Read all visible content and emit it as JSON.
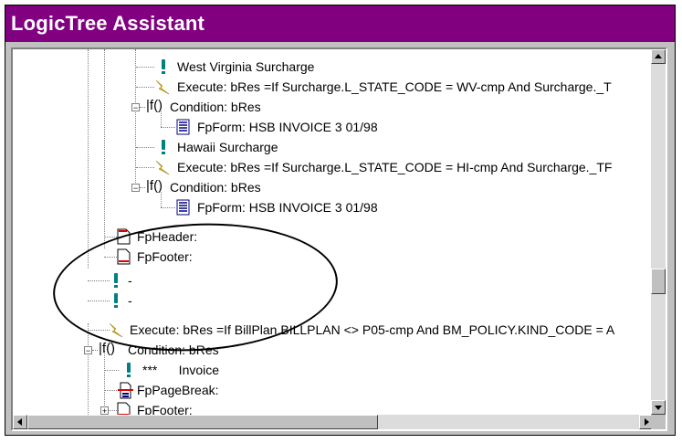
{
  "window": {
    "title": "LogicTree Assistant"
  },
  "tree": {
    "rows": [
      {
        "icon": "exclamation-icon",
        "label": "West Virginia Surcharge"
      },
      {
        "icon": "lightning-icon",
        "label": "Execute: bRes =If Surcharge.L_STATE_CODE = WV-cmp And Surcharge._T"
      },
      {
        "icon": "function-icon",
        "label": "Condition: bRes"
      },
      {
        "icon": "form-icon",
        "label": "FpForm: HSB INVOICE 3 01/98"
      },
      {
        "icon": "exclamation-icon",
        "label": "Hawaii Surcharge"
      },
      {
        "icon": "lightning-icon",
        "label": "Execute: bRes =If Surcharge.L_STATE_CODE = HI-cmp And Surcharge._TF"
      },
      {
        "icon": "function-icon",
        "label": "Condition: bRes"
      },
      {
        "icon": "form-icon",
        "label": "FpForm: HSB INVOICE 3 01/98"
      },
      {
        "icon": "header-page-icon",
        "label": "FpHeader:"
      },
      {
        "icon": "footer-page-icon",
        "label": "FpFooter:"
      },
      {
        "icon": "exclamation-icon",
        "label": "-"
      },
      {
        "icon": "exclamation-icon",
        "label": "-"
      },
      {
        "icon": "lightning-icon",
        "label": "Execute: bRes =If BillPlan.BILLPLAN <> P05-cmp And BM_POLICY.KIND_CODE = A"
      },
      {
        "icon": "function-icon",
        "label": "Condition: bRes"
      },
      {
        "icon": "exclamation-icon",
        "label": "***      Invoice"
      },
      {
        "icon": "page-break-icon",
        "label": "FpPageBreak:"
      },
      {
        "icon": "footer-page-icon",
        "label": "FpFooter:"
      }
    ]
  },
  "colors": {
    "titlebar": "#800080",
    "exclamation": "#008080",
    "lightning": "#e0c000",
    "form": "#000080",
    "page_red": "#e00000"
  }
}
